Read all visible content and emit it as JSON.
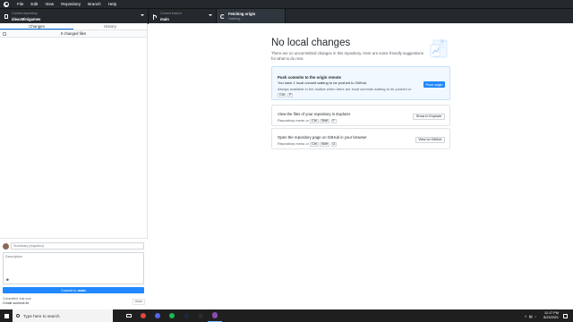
{
  "menubar": {
    "items": [
      "File",
      "Edit",
      "View",
      "Repository",
      "Branch",
      "Help"
    ]
  },
  "toolbar": {
    "repo_label": "Current repository",
    "repo_value": "ideasMinigames",
    "branch_label": "Current branch",
    "branch_value": "main",
    "fetch_label": "Fetching origin",
    "fetch_value": "Hashing..."
  },
  "sidebar": {
    "tabs": [
      "Changes",
      "History"
    ],
    "changes_count": "0 changed files",
    "summary_placeholder": "Summary (required)",
    "description_placeholder": "Description",
    "commit_button_prefix": "Commit to",
    "commit_button_branch": "main",
    "last_commit_label": "Committed Just now",
    "last_commit_summary": "Create sushiroe.fix",
    "undo_label": "Undo"
  },
  "main": {
    "title": "No local changes",
    "subtitle": "There are no uncommitted changes in this repository. Here are some friendly suggestions for what to do next.",
    "push_card": {
      "title": "Push commits to the origin remote",
      "text": "You have 1 local commit waiting to be pushed to GitHub.",
      "hint": "Always available in the toolbar when there are local commits waiting to be pushed or",
      "shortcut_keys": [
        "Ctrl",
        "P"
      ],
      "button": "Push origin"
    },
    "explorer_card": {
      "title": "View the files of your repository in Explorer",
      "hint": "Repository menu or",
      "shortcut_keys": [
        "Ctrl",
        "Shift",
        "F"
      ],
      "button": "Show in Explorer"
    },
    "github_card": {
      "title": "Open the repository page on GitHub in your browser",
      "hint": "Repository menu or",
      "shortcut_keys": [
        "Ctrl",
        "Shift",
        "G"
      ],
      "button": "View on GitHub"
    }
  },
  "taskbar": {
    "search_placeholder": "Type here to search",
    "apps": [
      {
        "name": "task-view-icon",
        "color": "#ffffff"
      },
      {
        "name": "chrome-icon",
        "color": "#e8453c"
      },
      {
        "name": "discord-icon",
        "color": "#5865f2"
      },
      {
        "name": "spotify-icon",
        "color": "#1db954"
      },
      {
        "name": "steam-icon",
        "color": "#1b2838"
      },
      {
        "name": "epic-games-icon",
        "color": "#2a2a2a"
      },
      {
        "name": "github-desktop-icon",
        "color": "#8a4baf"
      }
    ],
    "time": "11:17 PM",
    "date": "8/23/2021"
  }
}
